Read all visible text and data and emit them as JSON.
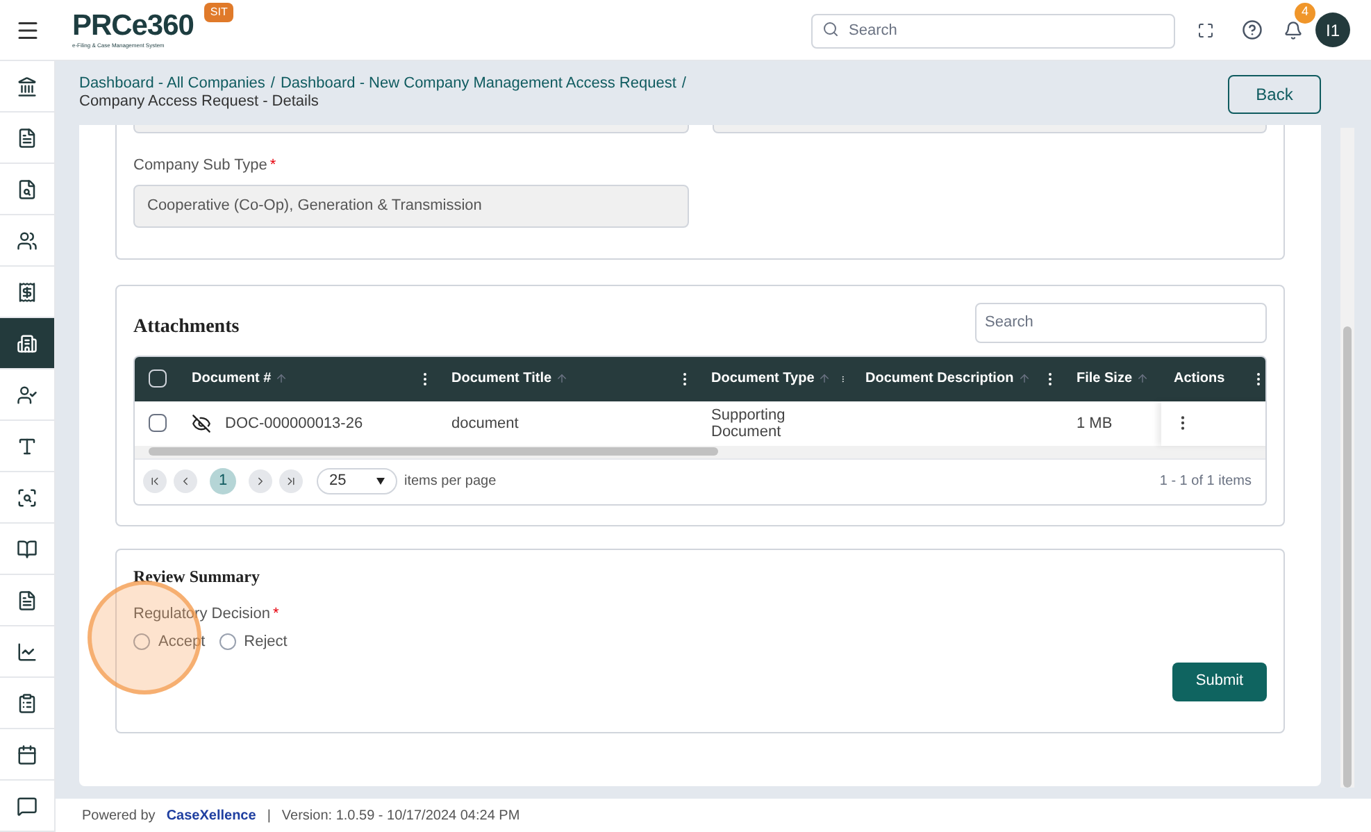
{
  "header": {
    "logo": "PRCe360",
    "logo_subtitle": "e-Filing & Case Management System",
    "env_badge": "SIT",
    "search": {
      "placeholder": "Search"
    },
    "notifications": "4",
    "avatar": "I1"
  },
  "sidebar": {
    "items": [
      {
        "selected": false
      },
      {
        "selected": false
      },
      {
        "selected": false
      },
      {
        "selected": false
      },
      {
        "selected": false
      },
      {
        "selected": true
      },
      {
        "selected": false
      },
      {
        "selected": false
      },
      {
        "selected": false
      },
      {
        "selected": false
      },
      {
        "selected": false
      },
      {
        "selected": false
      },
      {
        "selected": false
      },
      {
        "selected": false
      },
      {
        "selected": false
      }
    ]
  },
  "breadcrumb": [
    {
      "label": "Dashboard - All Companies",
      "kind": "link"
    },
    {
      "label": "/",
      "kind": "separator"
    },
    {
      "label": "Dashboard - New Company Management Access Request",
      "kind": "link"
    },
    {
      "label": "/",
      "kind": "separator"
    },
    {
      "label": "Company Access Request - Details",
      "kind": "current"
    }
  ],
  "back_button": "Back",
  "company_section": {
    "fields": [
      {
        "label": "Company Sub Type",
        "required_mark": "*",
        "value": "Cooperative (Co-Op), Generation & Transmission"
      }
    ]
  },
  "attachments": {
    "title": "Attachments",
    "search": {
      "placeholder": "Search"
    },
    "table": {
      "header_checked": false,
      "columns": [
        {
          "label": "Document #",
          "sortable": true
        },
        {
          "label": "Document Title",
          "sortable": true
        },
        {
          "label": "Document Type",
          "sortable": true
        },
        {
          "label": "Document Description",
          "sortable": true
        },
        {
          "label": "File Size",
          "sortable": true
        },
        {
          "label": "Actions",
          "sortable": false
        }
      ],
      "rows": [
        {
          "checked": false,
          "cells": [
            "DOC-000000013-26",
            "document",
            "Supporting Document",
            "",
            "1 MB"
          ]
        }
      ]
    },
    "pager": {
      "pages": [
        {
          "label": "1",
          "selected": true
        }
      ],
      "page_size": "25",
      "page_size_label": "items per page",
      "summary": "1 - 1 of 1 items"
    }
  },
  "review": {
    "title": "Review Summary",
    "field_label": "Regulatory Decision",
    "required_mark": "*",
    "options": [
      {
        "label": "Accept",
        "selected": false
      },
      {
        "label": "Reject",
        "selected": false
      }
    ],
    "submit": "Submit"
  },
  "footer": {
    "powered_by": "Powered by",
    "brand": "CaseXellence",
    "separator": "|",
    "version": "Version: 1.0.59 - 10/17/2024 04:24 PM"
  }
}
